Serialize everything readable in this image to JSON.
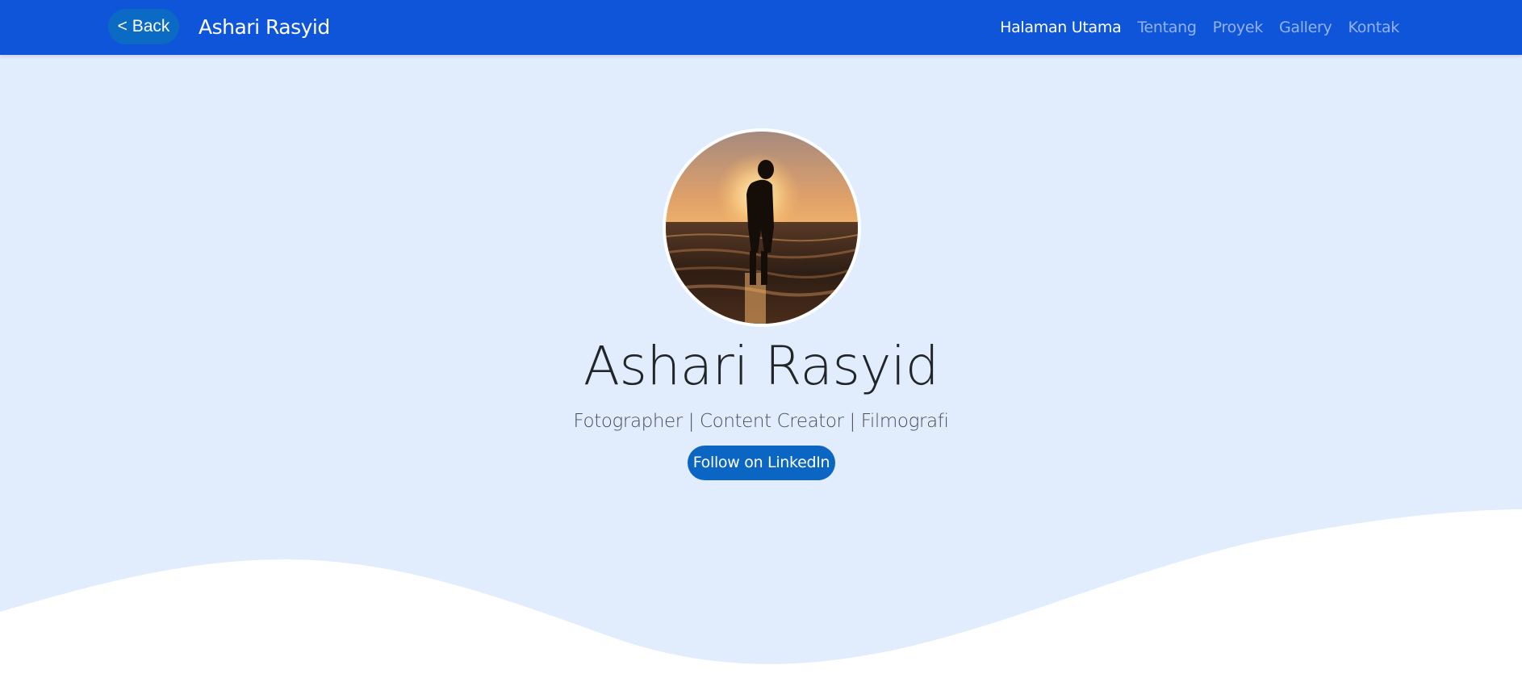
{
  "navbar": {
    "back_label": "< Back",
    "brand": "Ashari Rasyid",
    "links": [
      {
        "label": "Halaman Utama",
        "active": true
      },
      {
        "label": "Tentang",
        "active": false
      },
      {
        "label": "Proyek",
        "active": false
      },
      {
        "label": "Gallery",
        "active": false
      },
      {
        "label": "Kontak",
        "active": false
      }
    ],
    "background_color": "#0f55d9"
  },
  "hero": {
    "avatar": "profile-photo",
    "name": "Ashari Rasyid",
    "tagline": "Fotographer | Content Creator | Filmografi",
    "cta_label": "Follow on LinkedIn",
    "background_color": "#e1ecfd",
    "cta_color": "#0a66c2"
  }
}
